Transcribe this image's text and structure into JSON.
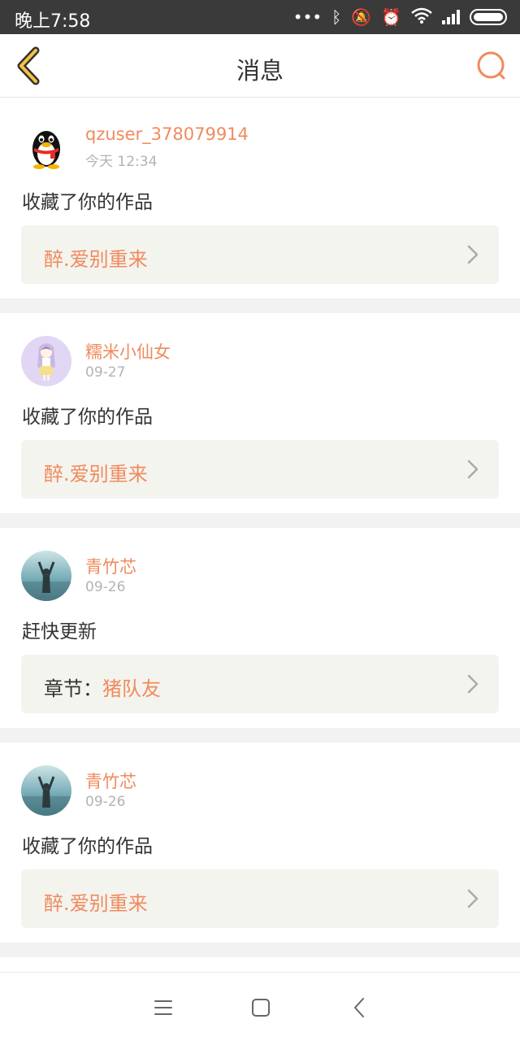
{
  "status_bar": {
    "time": "晚上7:58",
    "icons": [
      "more-icon",
      "bluetooth-icon",
      "mute-icon",
      "alarm-icon",
      "wifi-icon",
      "signal-icon",
      "battery-icon"
    ]
  },
  "header": {
    "title": "消息",
    "back_icon": "chevron-left-icon",
    "search_icon": "search-icon"
  },
  "colors": {
    "accent": "#f08a5d",
    "text": "#333333",
    "muted": "#b3b3b3",
    "box": "#f4f4ef",
    "divider": "#f2f2f2",
    "statusbar": "#3a3a3a"
  },
  "messages": [
    {
      "username": "qzuser_378079914",
      "time": "今天 12:34",
      "action": "收藏了你的作品",
      "work_prefix": "",
      "work_title": "醉.爱别重来",
      "avatar": "qq-penguin-avatar"
    },
    {
      "username": "糯米小仙女",
      "time": "09-27",
      "action": "收藏了你的作品",
      "work_prefix": "",
      "work_title": "醉.爱别重来",
      "avatar": "anime-girl-avatar"
    },
    {
      "username": "青竹芯",
      "time": "09-26",
      "action": "赶快更新",
      "work_prefix": "章节：",
      "work_title": "猪队友",
      "avatar": "sea-photo-avatar"
    },
    {
      "username": "青竹芯",
      "time": "09-26",
      "action": "收藏了你的作品",
      "work_prefix": "",
      "work_title": "醉.爱别重来",
      "avatar": "sea-photo-avatar"
    }
  ],
  "nav_bar": {
    "icons": [
      "menu-icon",
      "home-square-icon",
      "back-arrow-icon"
    ]
  }
}
